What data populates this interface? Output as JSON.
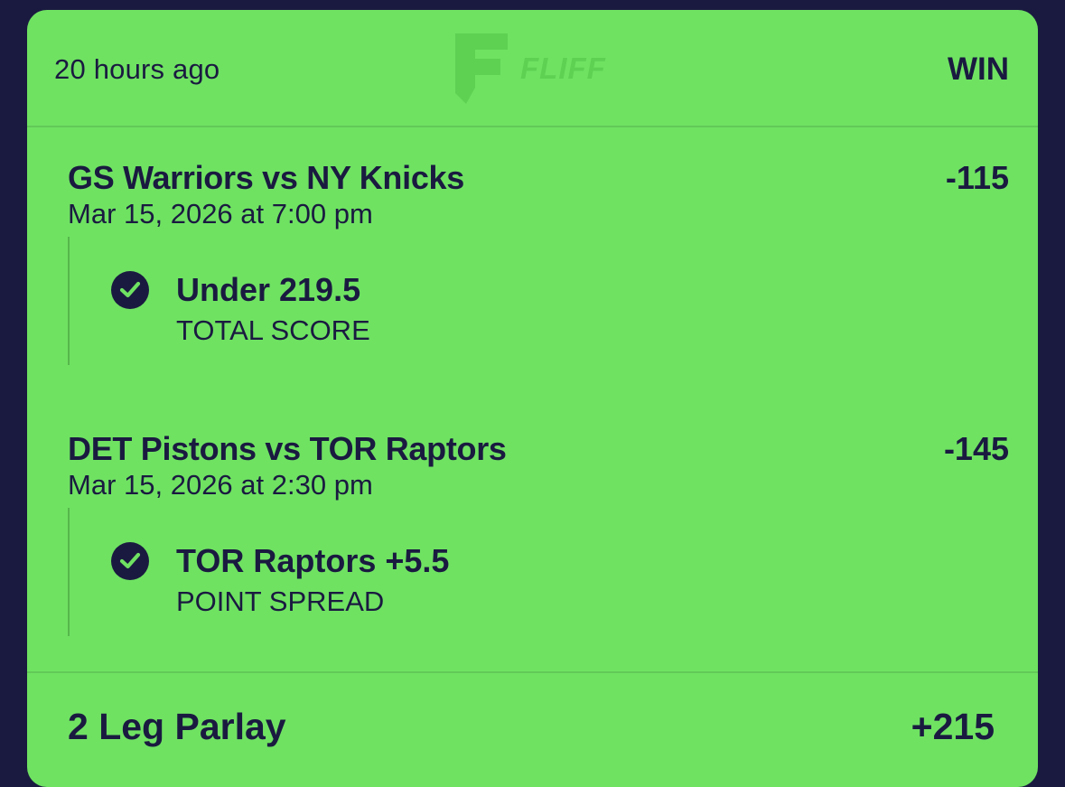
{
  "header": {
    "time_ago": "20 hours ago",
    "logo_text": "FLIFF",
    "status": "WIN"
  },
  "legs": [
    {
      "matchup": "GS Warriors vs NY Knicks",
      "odds": "-115",
      "datetime": "Mar 15, 2026 at 7:00 pm",
      "pick": "Under 219.5",
      "market": "TOTAL SCORE",
      "result_icon": "check-circle-icon"
    },
    {
      "matchup": "DET Pistons vs TOR Raptors",
      "odds": "-145",
      "datetime": "Mar 15, 2026 at 2:30 pm",
      "pick": "TOR Raptors +5.5",
      "market": "POINT SPREAD",
      "result_icon": "check-circle-icon"
    }
  ],
  "footer": {
    "parlay_label": "2 Leg Parlay",
    "parlay_odds": "+215"
  },
  "colors": {
    "background": "#1a1a40",
    "card": "#6fe262",
    "text": "#1a1a40",
    "logo": "#5ed153"
  }
}
